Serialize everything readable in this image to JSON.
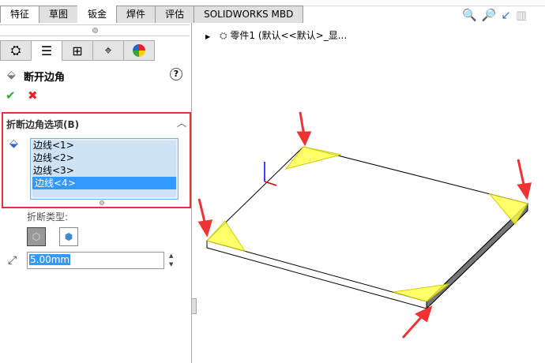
{
  "tabs": [
    "特征",
    "草图",
    "钣金",
    "焊件",
    "评估",
    "SOLIDWORKS MBD"
  ],
  "active_tab": "钣金",
  "property_manager": {
    "title": "断开边角",
    "section_title": "折断边角选项(B)",
    "edges": [
      "边线<1>",
      "边线<2>",
      "边线<3>",
      "边线<4>"
    ],
    "selected_edge": "边线<4>",
    "break_type_label": "折断类型:",
    "distance_value": "5.00mm"
  },
  "tree": {
    "part_label": "零件1  (默认<<默认>_显..."
  },
  "colors": {
    "highlight": "#e53333",
    "selection": "#3399ff",
    "corner": "#ffff33"
  }
}
